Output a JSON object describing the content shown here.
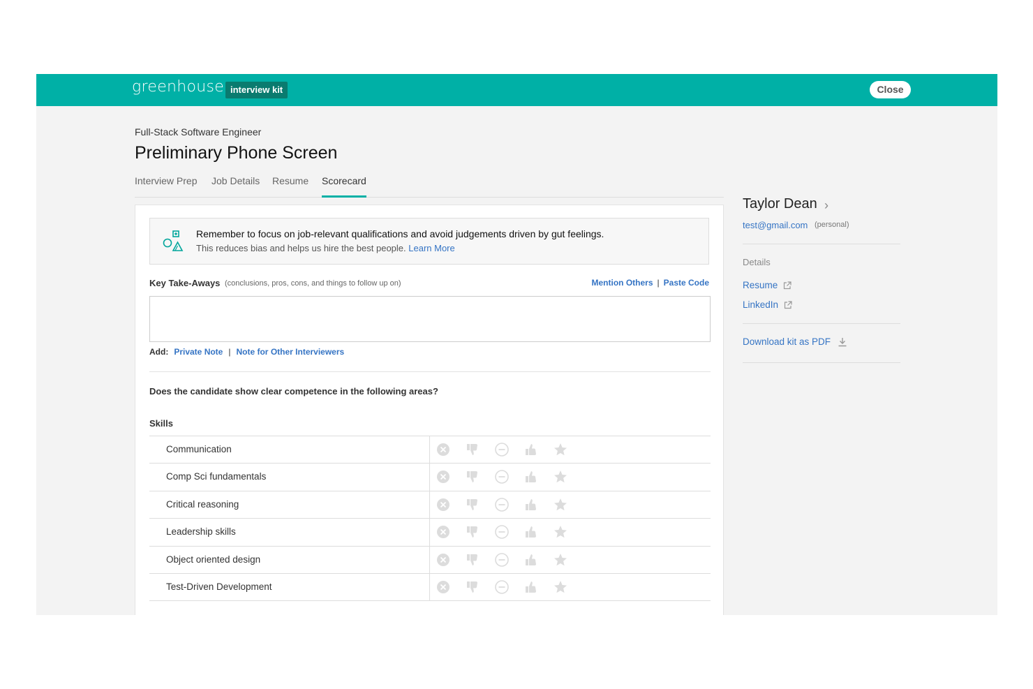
{
  "header": {
    "logo": "greenhouse",
    "badge": "interview kit",
    "close_label": "Close",
    "brand_color": "#00b0a6"
  },
  "page": {
    "job_title": "Full-Stack Software Engineer",
    "title": "Preliminary Phone Screen"
  },
  "tabs": [
    {
      "label": "Interview Prep",
      "active": false
    },
    {
      "label": "Job Details",
      "active": false
    },
    {
      "label": "Resume",
      "active": false
    },
    {
      "label": "Scorecard",
      "active": true
    }
  ],
  "notice": {
    "main": "Remember to focus on job-relevant qualifications and avoid judgements driven by gut feelings.",
    "sub": "This reduces bias and helps us hire the best people.",
    "link": "Learn More"
  },
  "takeaways": {
    "label": "Key Take-Aways",
    "hint": "(conclusions, pros, cons, and things to follow up on)",
    "mention_link": "Mention Others",
    "paste_link": "Paste Code",
    "value": "",
    "add_label": "Add:",
    "private_note": "Private Note",
    "other_note": "Note for Other Interviewers"
  },
  "question": "Does the candidate show clear competence in the following areas?",
  "skills": {
    "heading": "Skills",
    "rating_icons": [
      "definitely-not-icon",
      "thumbs-down-icon",
      "mixed-icon",
      "thumbs-up-icon",
      "star-icon"
    ],
    "items": [
      {
        "name": "Communication"
      },
      {
        "name": "Comp Sci fundamentals"
      },
      {
        "name": "Critical reasoning"
      },
      {
        "name": "Leadership skills"
      },
      {
        "name": "Object oriented design"
      },
      {
        "name": "Test-Driven Development"
      }
    ]
  },
  "candidate": {
    "name": "Taylor Dean",
    "email": "test@gmail.com",
    "email_type": "(personal)",
    "details_label": "Details",
    "resume_link": "Resume",
    "linkedin_link": "LinkedIn",
    "download_link": "Download kit as PDF"
  }
}
